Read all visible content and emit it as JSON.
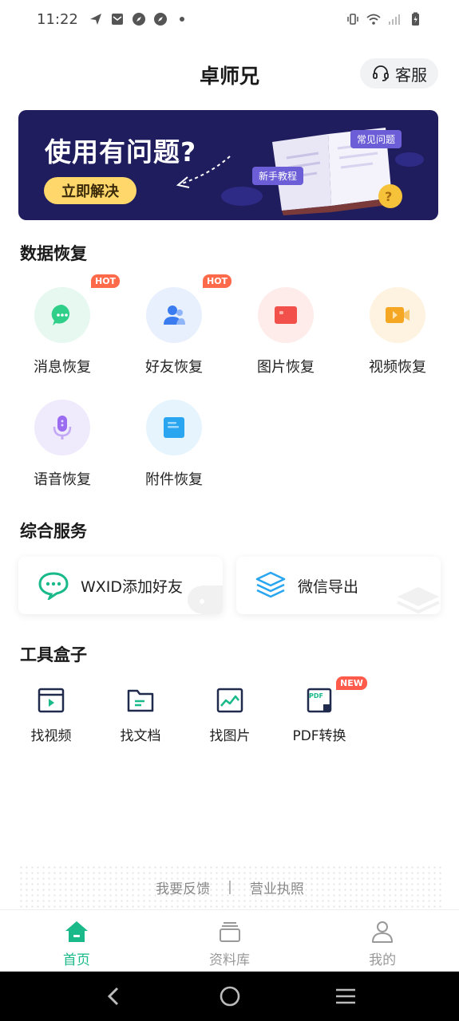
{
  "status_bar": {
    "time": "11:22"
  },
  "header": {
    "title": "卓师兄",
    "service_label": "客服"
  },
  "banner": {
    "title": "使用有问题?",
    "button_label": "立即解决",
    "tag_faq": "常见问题",
    "tag_tutorial": "新手教程"
  },
  "data_recovery": {
    "title": "数据恢复",
    "items": [
      {
        "label": "消息恢复",
        "badge": "HOT",
        "icon": "message-icon",
        "color": "#2fcf8a"
      },
      {
        "label": "好友恢复",
        "badge": "HOT",
        "icon": "contacts-icon",
        "color": "#3a7bf0"
      },
      {
        "label": "图片恢复",
        "badge": "",
        "icon": "image-icon",
        "color": "#f2504a"
      },
      {
        "label": "视频恢复",
        "badge": "",
        "icon": "video-icon",
        "color": "#f5a623"
      },
      {
        "label": "语音恢复",
        "badge": "",
        "icon": "microphone-icon",
        "color": "#9a6bf0"
      },
      {
        "label": "附件恢复",
        "badge": "",
        "icon": "file-icon",
        "color": "#2aa6f0"
      }
    ]
  },
  "services": {
    "title": "综合服务",
    "items": [
      {
        "label": "WXID添加好友",
        "icon": "chat-bubble-icon"
      },
      {
        "label": "微信导出",
        "icon": "layers-icon"
      }
    ]
  },
  "tools": {
    "title": "工具盒子",
    "items": [
      {
        "label": "找视频",
        "icon": "video-file-icon",
        "badge": ""
      },
      {
        "label": "找文档",
        "icon": "folder-icon",
        "badge": ""
      },
      {
        "label": "找图片",
        "icon": "picture-icon",
        "badge": ""
      },
      {
        "label": "PDF转换",
        "icon": "pdf-icon",
        "badge": "NEW"
      }
    ]
  },
  "footer": {
    "feedback": "我要反馈",
    "separator": "|",
    "license": "营业执照"
  },
  "tab_bar": {
    "tabs": [
      {
        "label": "首页",
        "active": true
      },
      {
        "label": "资料库",
        "active": false
      },
      {
        "label": "我的",
        "active": false
      }
    ]
  },
  "colors": {
    "accent": "#19b98a",
    "banner_bg": "#1f1d5e",
    "banner_button": "#ffd76a",
    "hot_badge": "#ff6b4a"
  }
}
